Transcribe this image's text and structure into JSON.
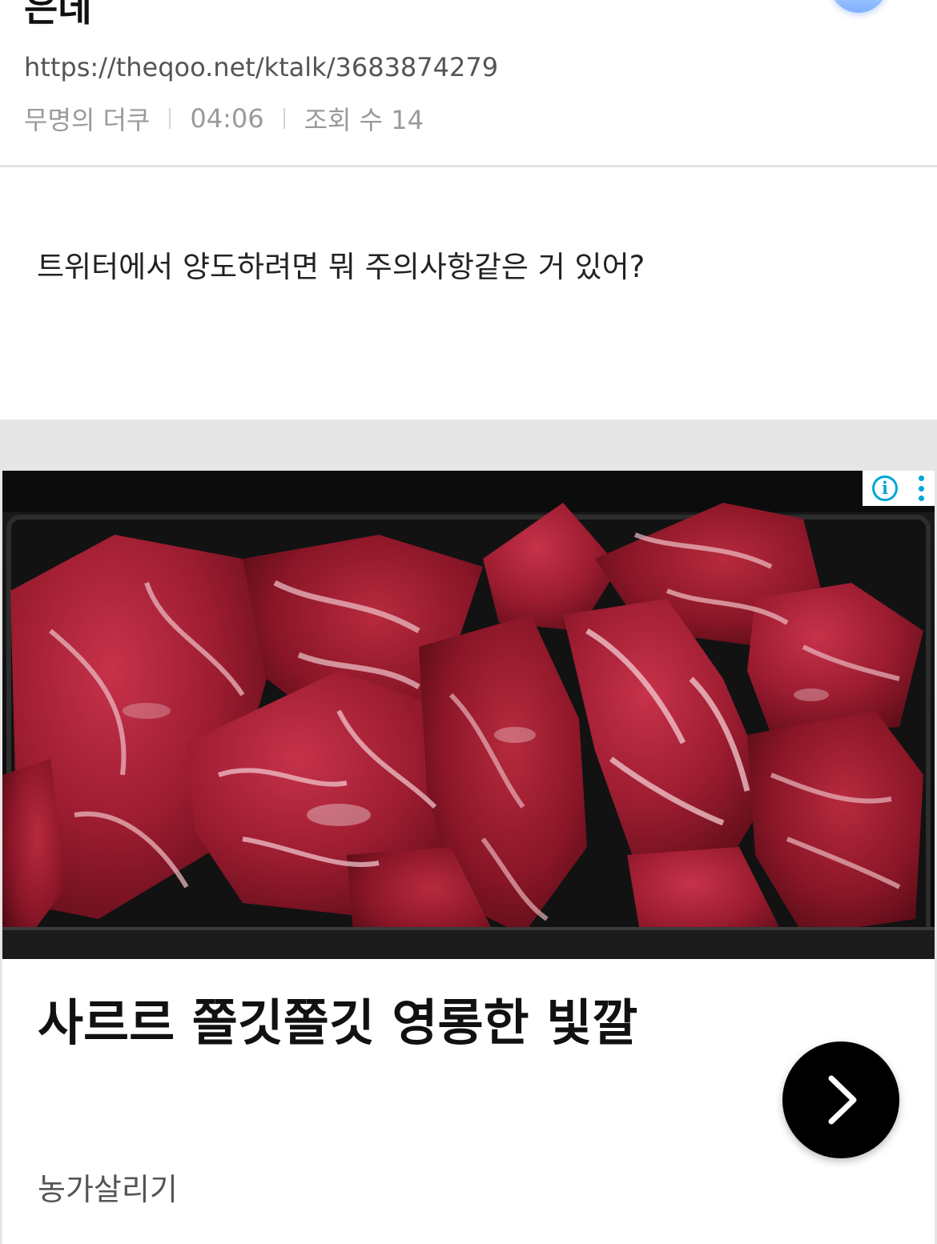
{
  "post": {
    "title": "은데",
    "url": "https://theqoo.net/ktalk/3683874279",
    "author": "무명의 더쿠",
    "time": "04:06",
    "views_label": "조회 수 14",
    "body": "트위터에서 양도하려면 뭐 주의사항같은 거 있어?"
  },
  "ad": {
    "image_subject": "raw marinated beef cuts in a black tray",
    "headline": "사르르 쫄깃쫄깃 영롱한 빛깔",
    "advertiser": "농가살리기",
    "choices_icons": [
      "info-icon",
      "kebab-menu-icon"
    ],
    "cta_icon": "chevron-right-icon"
  },
  "colors": {
    "divider": "#e2e2e2",
    "ad_background": "#e6e6e6",
    "ad_choices": "#00a6d6",
    "cta": "#000000"
  }
}
